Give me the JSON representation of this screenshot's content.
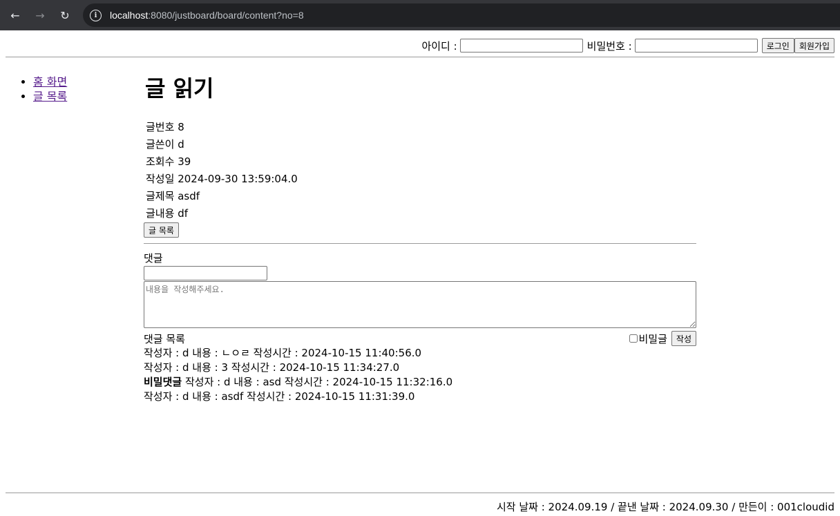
{
  "browser": {
    "back_icon": "←",
    "forward_icon": "→",
    "reload_icon": "↻",
    "url_host": "localhost",
    "url_rest": ":8080/justboard/board/content?no=8"
  },
  "login": {
    "id_label": "아이디 :",
    "id_value": "",
    "pw_label": "비밀번호 :",
    "pw_value": "",
    "login_button": "로그인",
    "signup_button": "회원가입"
  },
  "nav": {
    "items": [
      {
        "label": "홈 화면"
      },
      {
        "label": "글 목록"
      }
    ]
  },
  "post": {
    "title": "글 읽기",
    "rows": [
      {
        "label": "글번호",
        "value": "8"
      },
      {
        "label": "글쓴이",
        "value": "d"
      },
      {
        "label": "조회수",
        "value": "39"
      },
      {
        "label": "작성일",
        "value": "2024-09-30 13:59:04.0"
      },
      {
        "label": "글제목",
        "value": "asdf"
      },
      {
        "label": "글내용",
        "value": "df"
      }
    ],
    "list_button": "글 목록"
  },
  "comment_form": {
    "label": "댓글",
    "author_value": "",
    "content_placeholder": "내용을 작성해주세요.",
    "list_label": "댓글 목록",
    "secret_label": "비밀글",
    "submit_button": "작성"
  },
  "comments": [
    {
      "secret": "",
      "text": "작성자 : d 내용 : ㄴㅇㄹ 작성시간 : 2024-10-15 11:40:56.0"
    },
    {
      "secret": "",
      "text": "작성자 : d 내용 : 3 작성시간 : 2024-10-15 11:34:27.0"
    },
    {
      "secret": "비밀댓글",
      "text": " 작성자 : d 내용 : asd 작성시간 : 2024-10-15 11:32:16.0"
    },
    {
      "secret": "",
      "text": "작성자 : d 내용 : asdf 작성시간 : 2024-10-15 11:31:39.0"
    }
  ],
  "footer": {
    "text": "시작 날짜 : 2024.09.19 / 끝낸 날짜 : 2024.09.30 / 만든이 : 001cloudid"
  }
}
